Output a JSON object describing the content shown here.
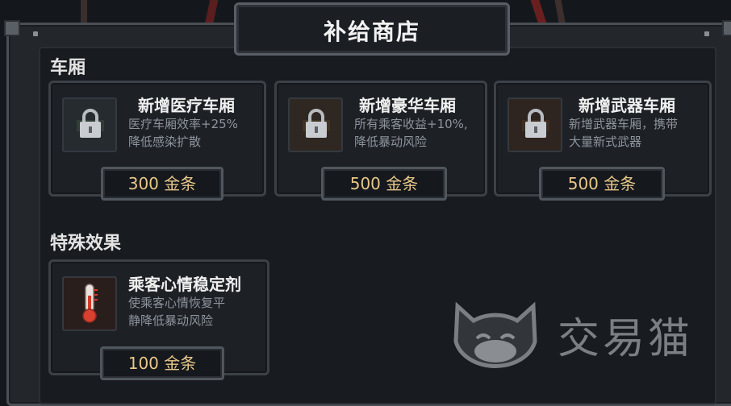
{
  "title": "补给商店",
  "sections": [
    {
      "title": "车厢",
      "items": [
        {
          "name": "新增医疗车厢",
          "desc_lines": [
            "医疗车厢效率+25%",
            "降低感染扩散"
          ],
          "price": "300 金条",
          "icon": "lock-icon",
          "locked": true
        },
        {
          "name": "新增豪华车厢",
          "desc_lines": [
            "所有乘客收益+10%,",
            "降低暴动风险"
          ],
          "price": "500 金条",
          "icon": "lock-icon",
          "locked": true
        },
        {
          "name": "新增武器车厢",
          "desc_lines": [
            "新增武器车厢，携带",
            "大量新式武器"
          ],
          "price": "500 金条",
          "icon": "lock-icon",
          "locked": true
        }
      ]
    },
    {
      "title": "特殊效果",
      "items": [
        {
          "name": "乘客心情稳定剂",
          "desc_lines": [
            "使乘客心情恢复平",
            "静降低暴动风险"
          ],
          "price": "100 金条",
          "icon": "thermometer-icon",
          "locked": false
        }
      ]
    }
  ],
  "watermark": {
    "text": "交易猫",
    "icon": "cat-logo-icon"
  },
  "colors": {
    "price_text": "#e8c78a",
    "panel_bg": "#23272c",
    "card_bg": "#1d2126"
  }
}
